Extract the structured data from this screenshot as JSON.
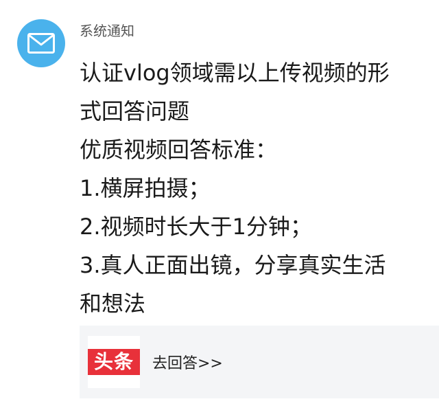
{
  "notification": {
    "sender": "系统通知",
    "avatar_icon": "mail-envelope-icon",
    "avatar_color": "#4ab2ec",
    "lines": [
      "认证vlog领域需以上传视频的形",
      "式回答问题",
      "优质视频回答标准：",
      "1.横屏拍摄；",
      "2.视频时长大于1分钟；",
      "3.真人正面出镜，分享真实生活",
      "和想法"
    ]
  },
  "link_card": {
    "logo_text": "头条",
    "logo_color": "#e8313a",
    "link_text": "去回答>>"
  }
}
